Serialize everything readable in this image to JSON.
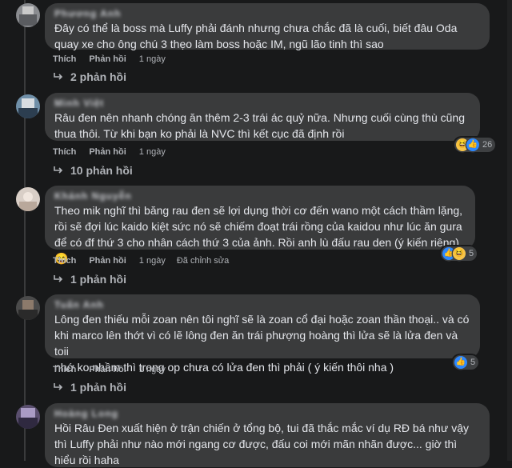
{
  "comments": [
    {
      "author": "Phương Anh",
      "text": "Đây có thể là boss mà Luffy phải đánh nhưng chưa chắc đã là cuối, biết đâu Oda\nquay xe cho ông chú 3 thẹo làm boss hoặc IM, ngũ lão tinh thì sao",
      "like": "Thích",
      "reply": "Phản hồi",
      "time": "1 ngày",
      "replies": "2 phản hồi"
    },
    {
      "author": "Minh Việt",
      "text": "Râu đen nên nhanh chóng ăn thêm 2-3 trái ác quỷ nữa. Nhưng cuối cùng thù cũng\nthua thôi. Từ khi bạn ko phải là NVC thì kết cục đã định rồi",
      "like": "Thích",
      "reply": "Phản hồi",
      "time": "1 ngày",
      "reaction_count": "26",
      "replies": "10 phản hồi"
    },
    {
      "author": "Khánh Nguyễn",
      "text": "Theo mik nghĩ thì băng rau đen sẽ lợi dụng thời cơ đến wano một cách thầm lặng,\nrồi sẽ đợi lúc kaido kiệt sức nó sẽ chiếm đoạt trái rồng của kaidou như lúc ăn gura\nđể có đf thứ 3 cho nhân cách thứ 3 của ảnh. Rồi anh lù đấu rau den (ý kiến riêng)",
      "emoji": "😄",
      "like": "Thích",
      "reply": "Phản hồi",
      "time": "1 ngày",
      "edited": "Đã chỉnh sửa",
      "reaction_count": "5",
      "replies": "1 phản hồi"
    },
    {
      "author": "Tuấn Anh",
      "text": "Lông đen thiếu mỗi zoan nên tôi nghĩ sẽ là zoan cổ đại hoặc zoan thần thoại.. và có\nkhi marco lên thớt vì có lẽ lông đen ăn trái phượng hoàng thì lửa sẽ là lửa đen và toii\nnhớ ko nhầm thì trong op chưa có lửa đen thì phải ( ý kiến thôi nha )",
      "like": "Thích",
      "reply": "Phản hồi",
      "time": "1 ngày",
      "reaction_count": "5",
      "replies": "1 phản hồi"
    },
    {
      "author": "Hoàng Long",
      "text": "Hồi Râu Đen xuất hiện ở trận chiến ở tổng bộ, tui đã thắc mắc ví dụ RĐ bá như vậy\nthì Luffy phải như nào mới ngang cơ được, đấu coi mới mãn nhãn được... giờ thì\nhiểu rồi haha"
    }
  ],
  "colors": {
    "background": "#18191a",
    "bubble": "#3a3b3c",
    "text": "#e4e6eb",
    "secondary": "#b0b3b8",
    "like_blue": "#2d88ff",
    "haha_yellow": "#f7c54a"
  },
  "icons": [
    "reply-arrow-icon",
    "like-reaction-icon",
    "haha-reaction-icon",
    "smile-emoji-icon"
  ]
}
